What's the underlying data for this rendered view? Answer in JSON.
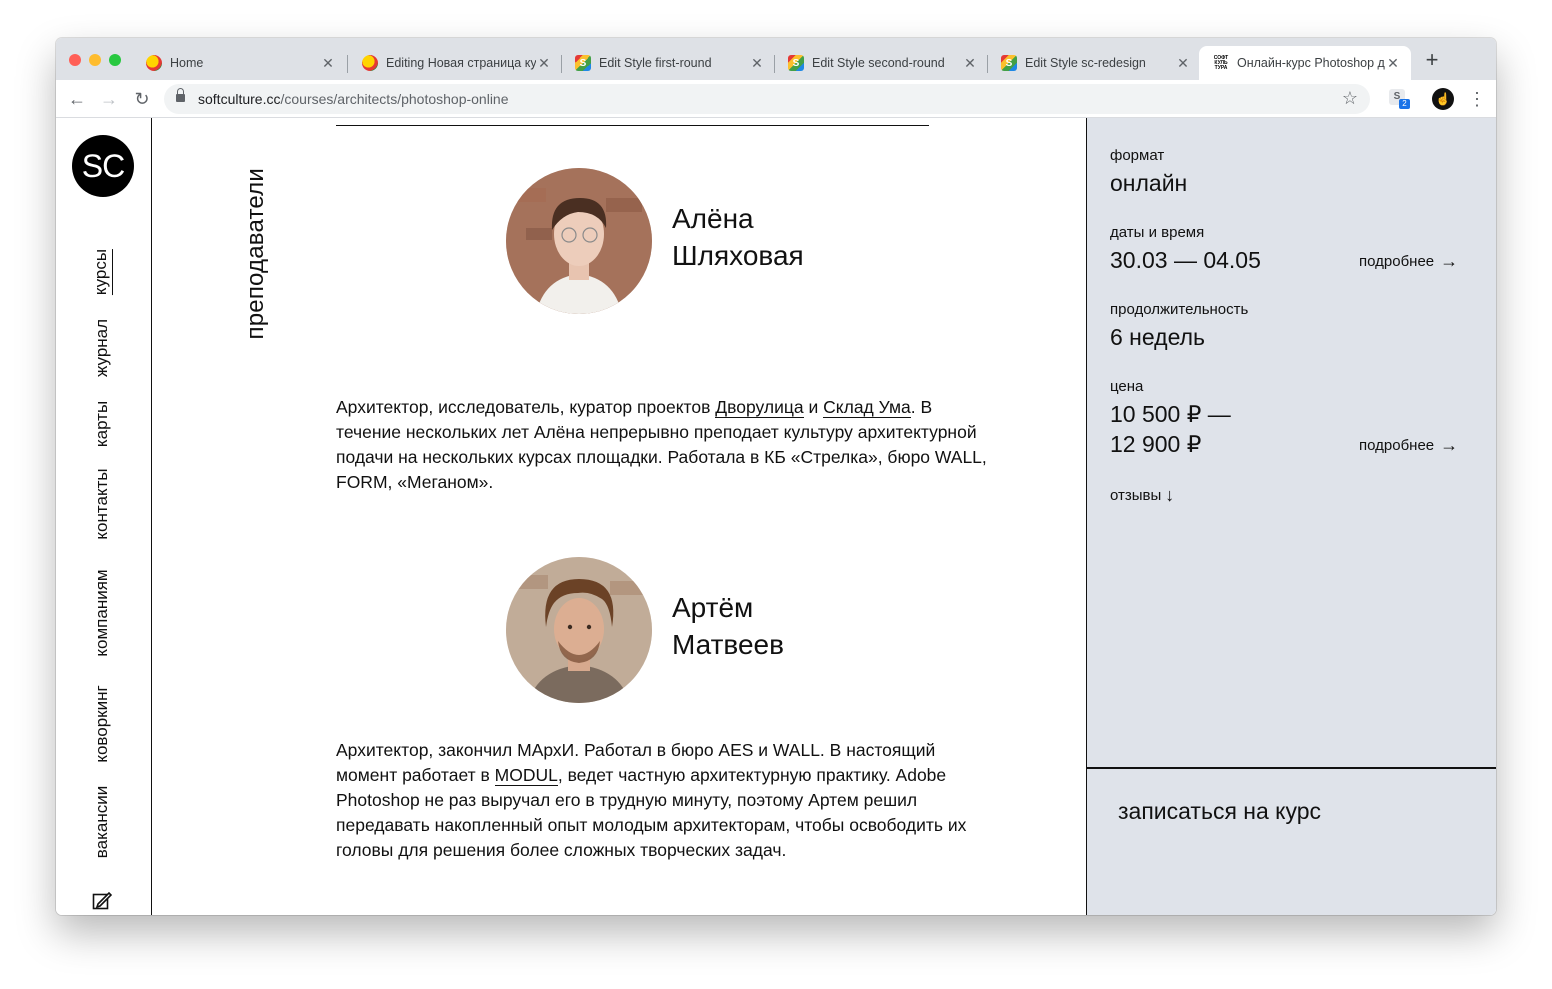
{
  "browser": {
    "tabs": [
      {
        "title": "Home",
        "favicon": "ball-favicon"
      },
      {
        "title": "Editing Новая страница ку",
        "favicon": "ball-favicon"
      },
      {
        "title": "Edit Style first-round",
        "favicon": "s-favicon"
      },
      {
        "title": "Edit Style second-round",
        "favicon": "s-favicon"
      },
      {
        "title": "Edit Style sc-redesign",
        "favicon": "s-favicon"
      },
      {
        "title": "Онлайн-курс Photoshop д",
        "favicon": "softculture-favicon",
        "active": true
      }
    ],
    "favicon_text": {
      "s": "S",
      "sc_line1": "СОФТ",
      "sc_line2": "КУЛЬ",
      "sc_line3": "ТУРА"
    },
    "new_tab": "+",
    "url_host": "softculture.cc",
    "url_path": "/courses/architects/photoshop-online",
    "extension_label": "S",
    "extension_badge": "2",
    "profile_glyph": "☝"
  },
  "sidebar": {
    "logo": "SC",
    "nav": [
      "курсы",
      "журнал",
      "карты",
      "контакты",
      "компаниям",
      "коворкинг",
      "вакансии"
    ]
  },
  "main": {
    "section_label": "преподаватели",
    "teachers": [
      {
        "first_name": "Алёна",
        "last_name": "Шляховая",
        "bio_parts": {
          "before": "Архитектор, исследователь, куратор проектов ",
          "link1": "Дворулица",
          "between": " и ",
          "link2": "Склад Ума",
          "after": ". В течение нескольких лет Алёна непрерывно преподает культуру архитектурной подачи на нескольких курсах площадки. Работала в КБ «Стрелка», бюро WALL, FORM, «Меганом»."
        }
      },
      {
        "first_name": "Артём",
        "last_name": "Матвеев",
        "bio_parts": {
          "before": "Архитектор, закончил МАрхИ. Работал в бюро AES и WALL. В настоящий момент работает в ",
          "link1": "MODUL",
          "after": ", ведет частную архитектурную практику. Adobe Photoshop не раз выручал его в трудную минуту, поэтому Артем решил передавать накопленный опыт молодым архитекторам, чтобы освободить их головы для решения более сложных творческих задач."
        }
      }
    ]
  },
  "aside": {
    "format_label": "формат",
    "format_value": "онлайн",
    "dates_label": "даты и время",
    "dates_value": "30.03 — 04.05",
    "duration_label": "продолжительность",
    "duration_value": "6 недель",
    "price_label": "цена",
    "price_value_line1": "10 500 ₽ —",
    "price_value_line2": "12 900 ₽",
    "more_label": "подробнее",
    "reviews_label": "отзывы",
    "enroll_label": "записаться на курс",
    "background_color": "#dfe3ea"
  }
}
